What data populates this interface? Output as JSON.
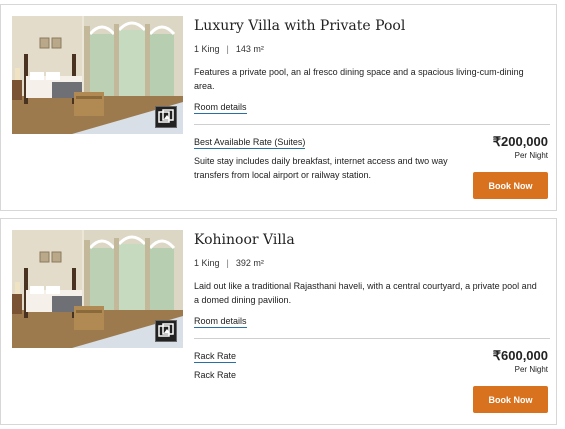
{
  "rooms": [
    {
      "title": "Luxury Villa with Private Pool",
      "bed": "1 King",
      "separator": "|",
      "size": "143 m²",
      "description": "Features a private pool, an al fresco dining space and a spacious living-cum-dining area.",
      "details_label": "Room details",
      "rate_name": "Best Available Rate (Suites)",
      "rate_description": "Suite stay includes daily breakfast, internet access and two way transfers from local airport or railway station.",
      "price": "₹200,000",
      "price_unit": "Per Night",
      "book_label": "Book Now"
    },
    {
      "title": "Kohinoor Villa",
      "bed": "1 King",
      "separator": "|",
      "size": "392 m²",
      "description": "Laid out like a traditional Rajasthani haveli, with a central courtyard, a private pool and a domed dining pavilion.",
      "details_label": "Room details",
      "rate_name": "Rack Rate",
      "rate_description": "Rack Rate",
      "price": "₹600,000",
      "price_unit": "Per Night",
      "book_label": "Book Now"
    }
  ],
  "colors": {
    "book_button": "#d9721f",
    "link_underline": "#2a6fa3",
    "card_border": "#d7d7d7"
  },
  "icons": {
    "gallery": "gallery-icon"
  }
}
